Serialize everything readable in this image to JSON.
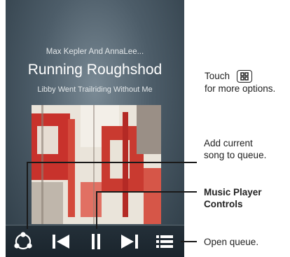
{
  "player": {
    "artist": "Max Kepler And AnnaLee...",
    "song_title": "Running Roughshod",
    "album": "Libby Went Trailriding Without  Me"
  },
  "controls": {
    "share_icon": "share-icon",
    "previous_icon": "previous-track-icon",
    "pause_icon": "pause-icon",
    "next_icon": "next-track-icon",
    "queue_icon": "queue-list-icon"
  },
  "callouts": {
    "touch_prefix": "Touch",
    "touch_suffix": "for more options.",
    "add_queue_line1": "Add current",
    "add_queue_line2": "song to queue.",
    "controls_line1": "Music Player",
    "controls_line2": "Controls",
    "open_queue": "Open queue."
  },
  "colors": {
    "background_dark": "#2d3b45",
    "art_red": "#c8322c",
    "art_cream": "#e8e2d8"
  }
}
